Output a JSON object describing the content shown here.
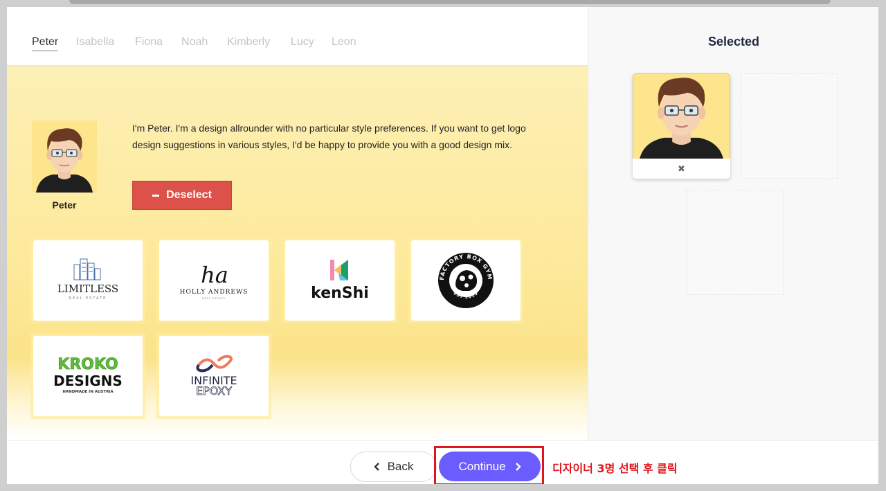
{
  "tabs": [
    "Peter",
    "Isabella",
    "Fiona",
    "Noah",
    "Kimberly",
    "Lucy",
    "Leon"
  ],
  "designer": {
    "name": "Peter",
    "description": "I'm Peter. I'm a design allrounder with no particular style preferences. If you want to get logo design suggestions in various styles, I'd be happy to provide you with a good design mix.",
    "deselect_label": "Deselect"
  },
  "logos": {
    "limitless": {
      "title": "LIMITLESS",
      "subtitle": "REAL ESTATE"
    },
    "holly": {
      "mark": "ha",
      "title": "HOLLY ANDREWS",
      "subtitle": "REAL ESTATE"
    },
    "kenshi": {
      "mark": "K",
      "title": "kenShi"
    },
    "factory": {
      "top": "FACTORY BOX GYM",
      "bottom": "EST 2015"
    },
    "kroko": {
      "line1": "KROKO",
      "line2": "DESIGNS",
      "line3": "HANDMADE IN AUSTRIA"
    },
    "infinite": {
      "line1": "INFINITE",
      "line2": "EPOXY"
    }
  },
  "selected": {
    "title": "Selected",
    "remove_glyph": "✖"
  },
  "footer": {
    "back_label": "Back",
    "continue_label": "Continue",
    "annotation": "디자이너 3명 선택 후 클릭"
  },
  "colors": {
    "accent": "#6b5cff",
    "deselect": "#dc5149",
    "highlight": "#e0161d",
    "panel_bg": "#fde99a"
  }
}
